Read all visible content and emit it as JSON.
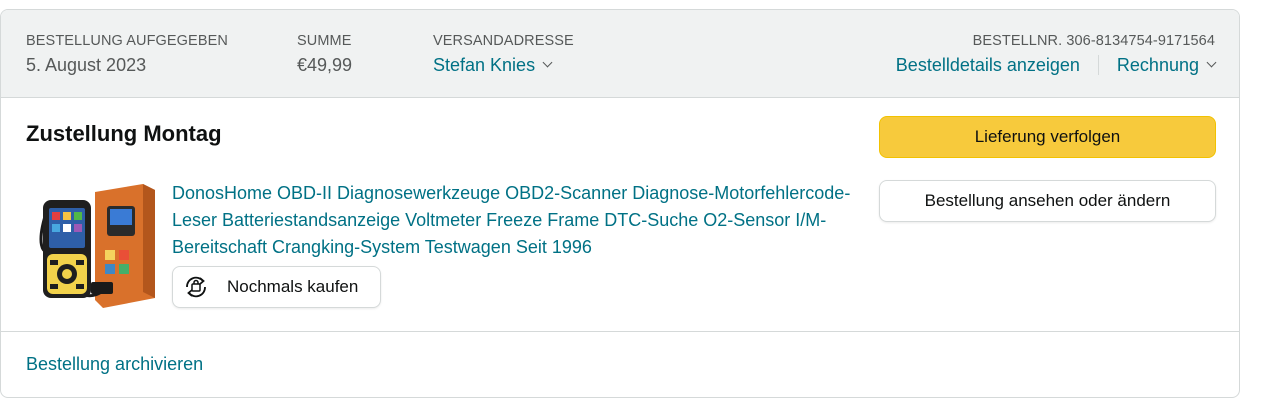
{
  "header": {
    "order_placed": {
      "label": "Bestellung aufgegeben",
      "value": "5. August 2023"
    },
    "total": {
      "label": "Summe",
      "value": "€49,99"
    },
    "ship_to": {
      "label": "Versandadresse",
      "value": "Stefan Knies"
    },
    "order_number": {
      "label": "Bestellnr. 306-8134754-9171564"
    },
    "details_link": "Bestelldetails anzeigen",
    "invoice_link": "Rechnung"
  },
  "shipment": {
    "title": "Zustellung Montag",
    "product_title": "DonosHome OBD-II Diagnosewerkzeuge OBD2-Scanner Diagnose-Motorfehlercode-Leser Batteriestandsanzeige Voltmeter Freeze Frame DTC-Suche O2-Sensor I/M-Bereitschaft Crangking-System Testwagen Seit 1996",
    "buy_again": "Nochmals kaufen"
  },
  "actions": {
    "track": "Lieferung verfolgen",
    "view_edit": "Bestellung ansehen oder ändern"
  },
  "footer": {
    "archive": "Bestellung archivieren"
  },
  "colors": {
    "link": "#007185",
    "primary_button": "#f7ca3c",
    "header_bg": "#f0f2f2",
    "border": "#d5d9d9"
  },
  "icons": {
    "buy_again_icon": "buy-again-cycle-icon",
    "dropdown_icon": "chevron-down-icon",
    "product_image": "obd2-scanner-product-image"
  }
}
